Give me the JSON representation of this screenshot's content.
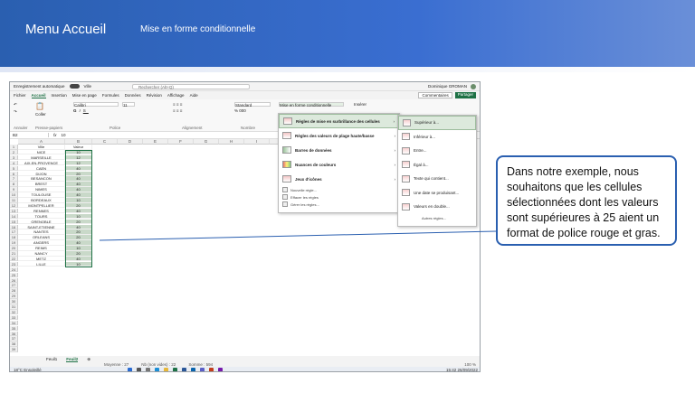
{
  "header": {
    "title": "Menu Accueil",
    "subtitle": "Mise en forme conditionnelle"
  },
  "callout": {
    "text": "Dans notre exemple, nous souhaitons que les cellules sélectionnées dont les valeurs sont supérieures à 25 aient un format de police rouge et gras."
  },
  "excel": {
    "autosave": "Enregistrement automatique",
    "file_name": "Ville",
    "search_placeholder": "Rechercher (Alt+Q)",
    "user_name": "Dominique GROMAN",
    "tabs": [
      "Fichier",
      "Accueil",
      "Insertion",
      "Mise en page",
      "Formules",
      "Données",
      "Révision",
      "Affichage",
      "Aide"
    ],
    "active_tab": "Accueil",
    "comments_button": "Commentaires",
    "share_button": "Partager",
    "ribbon": {
      "paste": "Coller",
      "font_name": "Calibri",
      "font_size": "11",
      "number_format": "Standard",
      "cond_format": "Mise en forme conditionnelle",
      "insert": "Insérer",
      "groups": [
        "Annuler",
        "Presse-papiers",
        "Police",
        "Alignement",
        "Nombre"
      ]
    },
    "formula_bar": {
      "name_box": "B2",
      "fx": "fx",
      "value": "10"
    },
    "columns": [
      "A",
      "B",
      "C",
      "D",
      "E",
      "F",
      "G",
      "H",
      "I",
      "J",
      "K",
      "L",
      "M",
      "N",
      "O",
      "P",
      "Q"
    ],
    "header_row": {
      "a": "Ville",
      "b": "Valeur"
    },
    "rows": [
      {
        "city": "NICE",
        "value": "10"
      },
      {
        "city": "MARSEILLE",
        "value": "12"
      },
      {
        "city": "AIX-EN-PROVENCE",
        "value": "12"
      },
      {
        "city": "CAEN",
        "value": "40"
      },
      {
        "city": "DIJON",
        "value": "20"
      },
      {
        "city": "BESANCON",
        "value": "40"
      },
      {
        "city": "BREST",
        "value": "40"
      },
      {
        "city": "NIMES",
        "value": "40"
      },
      {
        "city": "TOULOUSE",
        "value": "40"
      },
      {
        "city": "BORDEAUX",
        "value": "10"
      },
      {
        "city": "MONTPELLIER",
        "value": "20"
      },
      {
        "city": "RENNES",
        "value": "40"
      },
      {
        "city": "TOURS",
        "value": "10"
      },
      {
        "city": "GRENOBLE",
        "value": "20"
      },
      {
        "city": "SAINT-ETIENNE",
        "value": "40"
      },
      {
        "city": "NANTES",
        "value": "20"
      },
      {
        "city": "ORLEANS",
        "value": "20"
      },
      {
        "city": "ANGERS",
        "value": "40"
      },
      {
        "city": "REIMS",
        "value": "10"
      },
      {
        "city": "NANCY",
        "value": "20"
      },
      {
        "city": "METZ",
        "value": "40"
      },
      {
        "city": "LILLE",
        "value": "10"
      }
    ],
    "cond_menu": [
      {
        "label": "Règles de mise en surbrillance des cellules",
        "icon": "highlight-rules-icon"
      },
      {
        "label": "Règles des valeurs de plage haute/basse",
        "icon": "top-bottom-icon"
      },
      {
        "label": "Barres de données",
        "icon": "data-bars-icon"
      },
      {
        "label": "Nuances de couleurs",
        "icon": "color-scales-icon"
      },
      {
        "label": "Jeux d'icônes",
        "icon": "icon-sets-icon"
      }
    ],
    "cond_menu_small": [
      "Nouvelle règle...",
      "Effacer les règles",
      "Gérer les règles..."
    ],
    "sub_menu": [
      "Supérieur à...",
      "Inférieur à...",
      "Entre...",
      "Égal à...",
      "Texte qui contient...",
      "Une date se produisant...",
      "Valeurs en double..."
    ],
    "sub_menu_footer": "Autres règles...",
    "sheets": [
      "Feuil1",
      "Feuil2"
    ],
    "active_sheet": "Feuil2",
    "status": {
      "average": "Moyenne : 27",
      "count": "Nb (non vides) : 22",
      "sum": "Somme : 594",
      "zoom": "100 %"
    },
    "taskbar": {
      "weather": "18°C Ensoleillé",
      "time": "15:42",
      "date": "26/09/2022"
    }
  }
}
